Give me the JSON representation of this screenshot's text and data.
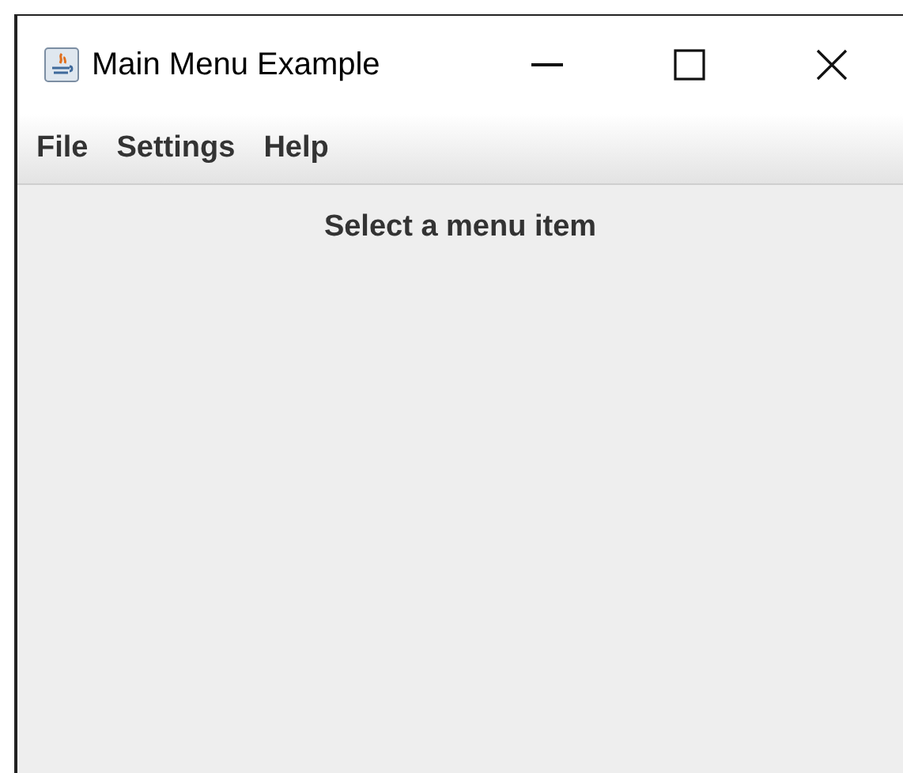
{
  "window": {
    "title": "Main Menu Example"
  },
  "menu_bar": {
    "items": [
      {
        "label": "File"
      },
      {
        "label": "Settings"
      },
      {
        "label": "Help"
      }
    ]
  },
  "content": {
    "label": "Select a menu item"
  }
}
